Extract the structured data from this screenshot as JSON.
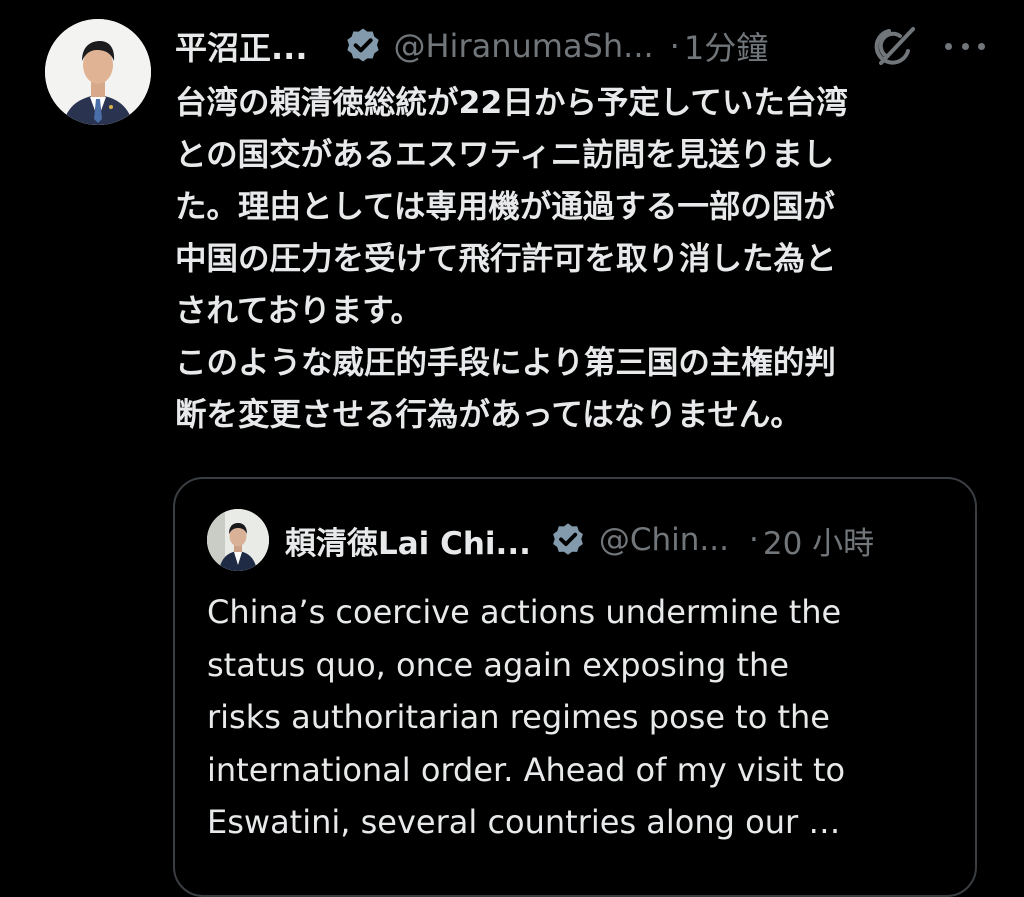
{
  "post": {
    "author": {
      "display_name": "平沼正...",
      "handle": "@HiranumaSh...",
      "verified_icon": "verified-badge-icon"
    },
    "separator": "·",
    "time": "1分鐘",
    "grok_icon": "grok-icon",
    "more_icon": "more-options-icon",
    "lines": [
      "台湾の頼清徳総統が22日から予定していた台湾",
      "との国交があるエスワティニ訪問を見送りまし",
      "た。理由としては専用機が通過する一部の国が",
      "中国の圧力を受けて飛行許可を取り消した為と",
      "されております。",
      "このような威圧的手段により第三国の主権的判",
      "断を変更させる行為があってはなりません。"
    ]
  },
  "quote": {
    "author": {
      "display_name": "頼清徳Lai Chi...",
      "handle": "@Chin...",
      "verified_icon": "verified-badge-icon"
    },
    "separator": "·",
    "time": "20 小時",
    "lines": [
      "China’s coercive actions undermine the",
      "status quo, once again exposing the",
      "risks authoritarian regimes pose to the",
      "international order. Ahead of my visit to",
      "Eswatini, several countries along our …"
    ]
  },
  "colors": {
    "background": "#000000",
    "text_primary": "#e7e9ea",
    "text_secondary": "#71767b",
    "quote_border": "#3a3d41",
    "verified_badge": "#829aab"
  }
}
